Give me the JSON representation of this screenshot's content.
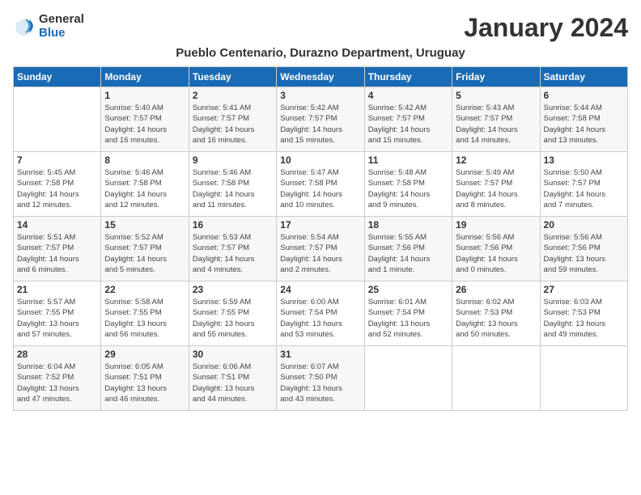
{
  "logo": {
    "general": "General",
    "blue": "Blue"
  },
  "title": "January 2024",
  "subtitle": "Pueblo Centenario, Durazno Department, Uruguay",
  "headers": [
    "Sunday",
    "Monday",
    "Tuesday",
    "Wednesday",
    "Thursday",
    "Friday",
    "Saturday"
  ],
  "weeks": [
    [
      {
        "day": "",
        "info": ""
      },
      {
        "day": "1",
        "info": "Sunrise: 5:40 AM\nSunset: 7:57 PM\nDaylight: 14 hours\nand 16 minutes."
      },
      {
        "day": "2",
        "info": "Sunrise: 5:41 AM\nSunset: 7:57 PM\nDaylight: 14 hours\nand 16 minutes."
      },
      {
        "day": "3",
        "info": "Sunrise: 5:42 AM\nSunset: 7:57 PM\nDaylight: 14 hours\nand 15 minutes."
      },
      {
        "day": "4",
        "info": "Sunrise: 5:42 AM\nSunset: 7:57 PM\nDaylight: 14 hours\nand 15 minutes."
      },
      {
        "day": "5",
        "info": "Sunrise: 5:43 AM\nSunset: 7:57 PM\nDaylight: 14 hours\nand 14 minutes."
      },
      {
        "day": "6",
        "info": "Sunrise: 5:44 AM\nSunset: 7:58 PM\nDaylight: 14 hours\nand 13 minutes."
      }
    ],
    [
      {
        "day": "7",
        "info": "Sunrise: 5:45 AM\nSunset: 7:58 PM\nDaylight: 14 hours\nand 12 minutes."
      },
      {
        "day": "8",
        "info": "Sunrise: 5:46 AM\nSunset: 7:58 PM\nDaylight: 14 hours\nand 12 minutes."
      },
      {
        "day": "9",
        "info": "Sunrise: 5:46 AM\nSunset: 7:58 PM\nDaylight: 14 hours\nand 11 minutes."
      },
      {
        "day": "10",
        "info": "Sunrise: 5:47 AM\nSunset: 7:58 PM\nDaylight: 14 hours\nand 10 minutes."
      },
      {
        "day": "11",
        "info": "Sunrise: 5:48 AM\nSunset: 7:58 PM\nDaylight: 14 hours\nand 9 minutes."
      },
      {
        "day": "12",
        "info": "Sunrise: 5:49 AM\nSunset: 7:57 PM\nDaylight: 14 hours\nand 8 minutes."
      },
      {
        "day": "13",
        "info": "Sunrise: 5:50 AM\nSunset: 7:57 PM\nDaylight: 14 hours\nand 7 minutes."
      }
    ],
    [
      {
        "day": "14",
        "info": "Sunrise: 5:51 AM\nSunset: 7:57 PM\nDaylight: 14 hours\nand 6 minutes."
      },
      {
        "day": "15",
        "info": "Sunrise: 5:52 AM\nSunset: 7:57 PM\nDaylight: 14 hours\nand 5 minutes."
      },
      {
        "day": "16",
        "info": "Sunrise: 5:53 AM\nSunset: 7:57 PM\nDaylight: 14 hours\nand 4 minutes."
      },
      {
        "day": "17",
        "info": "Sunrise: 5:54 AM\nSunset: 7:57 PM\nDaylight: 14 hours\nand 2 minutes."
      },
      {
        "day": "18",
        "info": "Sunrise: 5:55 AM\nSunset: 7:56 PM\nDaylight: 14 hours\nand 1 minute."
      },
      {
        "day": "19",
        "info": "Sunrise: 5:56 AM\nSunset: 7:56 PM\nDaylight: 14 hours\nand 0 minutes."
      },
      {
        "day": "20",
        "info": "Sunrise: 5:56 AM\nSunset: 7:56 PM\nDaylight: 13 hours\nand 59 minutes."
      }
    ],
    [
      {
        "day": "21",
        "info": "Sunrise: 5:57 AM\nSunset: 7:55 PM\nDaylight: 13 hours\nand 57 minutes."
      },
      {
        "day": "22",
        "info": "Sunrise: 5:58 AM\nSunset: 7:55 PM\nDaylight: 13 hours\nand 56 minutes."
      },
      {
        "day": "23",
        "info": "Sunrise: 5:59 AM\nSunset: 7:55 PM\nDaylight: 13 hours\nand 55 minutes."
      },
      {
        "day": "24",
        "info": "Sunrise: 6:00 AM\nSunset: 7:54 PM\nDaylight: 13 hours\nand 53 minutes."
      },
      {
        "day": "25",
        "info": "Sunrise: 6:01 AM\nSunset: 7:54 PM\nDaylight: 13 hours\nand 52 minutes."
      },
      {
        "day": "26",
        "info": "Sunrise: 6:02 AM\nSunset: 7:53 PM\nDaylight: 13 hours\nand 50 minutes."
      },
      {
        "day": "27",
        "info": "Sunrise: 6:03 AM\nSunset: 7:53 PM\nDaylight: 13 hours\nand 49 minutes."
      }
    ],
    [
      {
        "day": "28",
        "info": "Sunrise: 6:04 AM\nSunset: 7:52 PM\nDaylight: 13 hours\nand 47 minutes."
      },
      {
        "day": "29",
        "info": "Sunrise: 6:05 AM\nSunset: 7:51 PM\nDaylight: 13 hours\nand 46 minutes."
      },
      {
        "day": "30",
        "info": "Sunrise: 6:06 AM\nSunset: 7:51 PM\nDaylight: 13 hours\nand 44 minutes."
      },
      {
        "day": "31",
        "info": "Sunrise: 6:07 AM\nSunset: 7:50 PM\nDaylight: 13 hours\nand 43 minutes."
      },
      {
        "day": "",
        "info": ""
      },
      {
        "day": "",
        "info": ""
      },
      {
        "day": "",
        "info": ""
      }
    ]
  ]
}
